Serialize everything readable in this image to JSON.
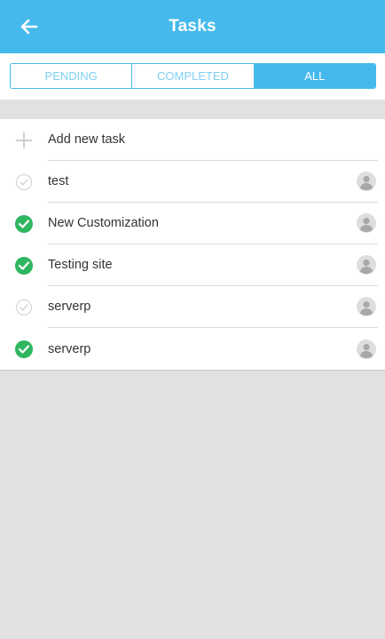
{
  "header": {
    "title": "Tasks",
    "back_icon": "arrow-left-icon"
  },
  "tabs": [
    {
      "label": "PENDING",
      "active": false
    },
    {
      "label": "COMPLETED",
      "active": false
    },
    {
      "label": "ALL",
      "active": true
    }
  ],
  "add_task": {
    "label": "Add new task",
    "icon": "plus-icon"
  },
  "tasks": [
    {
      "title": "test",
      "completed": false
    },
    {
      "title": "New Customization",
      "completed": true
    },
    {
      "title": "Testing site",
      "completed": true
    },
    {
      "title": "serverp",
      "completed": false
    },
    {
      "title": "serverp",
      "completed": true
    }
  ],
  "colors": {
    "primary": "#45b9ec",
    "done_green": "#2fb661",
    "background": "#e1e1e1"
  }
}
